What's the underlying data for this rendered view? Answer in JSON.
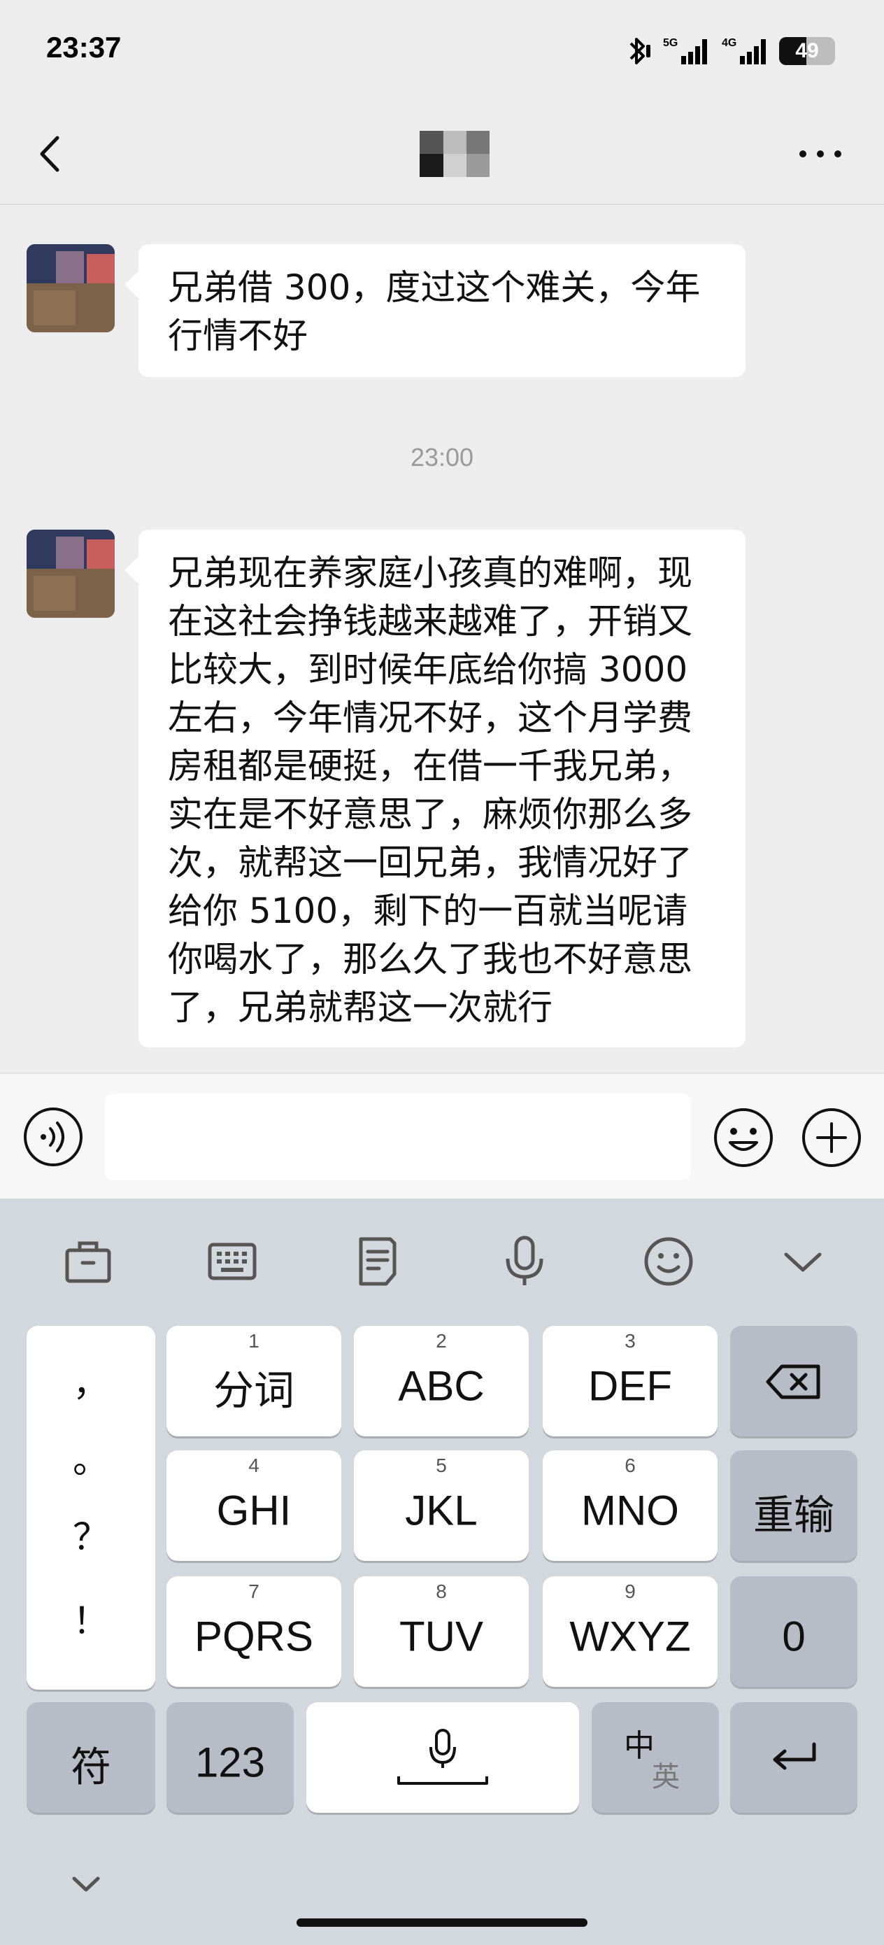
{
  "status_bar": {
    "time": "23:37",
    "network_1": "5G",
    "network_2": "4G",
    "battery": "49",
    "battery_level": 0.49
  },
  "nav": {
    "back_icon": "chevron-left-icon",
    "more_icon": "more-dots-icon"
  },
  "messages": [
    {
      "sender": "contact",
      "text": "兄弟借 300，度过这个难关，今年\n行情不好"
    },
    {
      "type": "timestamp",
      "text": "23:00"
    },
    {
      "sender": "contact",
      "text": "兄弟现在养家庭小孩真的难啊，现\n在这社会挣钱越来越难了，开销又\n比较大，到时候年底给你搞 3000\n左右，今年情况不好，这个月学费\n房租都是硬挺，在借一千我兄弟，\n实在是不好意思了，麻烦你那么多\n次，就帮这一回兄弟，我情况好了\n给你 5100，剩下的一百就当呢请\n你喝水了，那么久了我也不好意思\n了，兄弟就帮这一次就行"
    }
  ],
  "input_bar": {
    "value": "",
    "voice_icon": "voice-icon",
    "emoji_icon": "emoji-icon",
    "plus_icon": "plus-icon"
  },
  "keyboard": {
    "toolbar_icons": [
      "briefcase-icon",
      "keyboard-icon",
      "clipboard-icon",
      "microphone-icon",
      "smiley-icon",
      "chevron-down-icon"
    ],
    "punctuation": [
      "，",
      "。",
      "？",
      "！"
    ],
    "keys": {
      "k1": {
        "num": "1",
        "label": "分词"
      },
      "k2": {
        "num": "2",
        "label": "ABC"
      },
      "k3": {
        "num": "3",
        "label": "DEF"
      },
      "k4": {
        "num": "4",
        "label": "GHI"
      },
      "k5": {
        "num": "5",
        "label": "JKL"
      },
      "k6": {
        "num": "6",
        "label": "MNO"
      },
      "k7": {
        "num": "7",
        "label": "PQRS"
      },
      "k8": {
        "num": "8",
        "label": "TUV"
      },
      "k9": {
        "num": "9",
        "label": "WXYZ"
      },
      "reset": "重输",
      "zero": "0",
      "symbols": "符",
      "numbers": "123",
      "lang_main": "中",
      "lang_sub": "英"
    }
  }
}
